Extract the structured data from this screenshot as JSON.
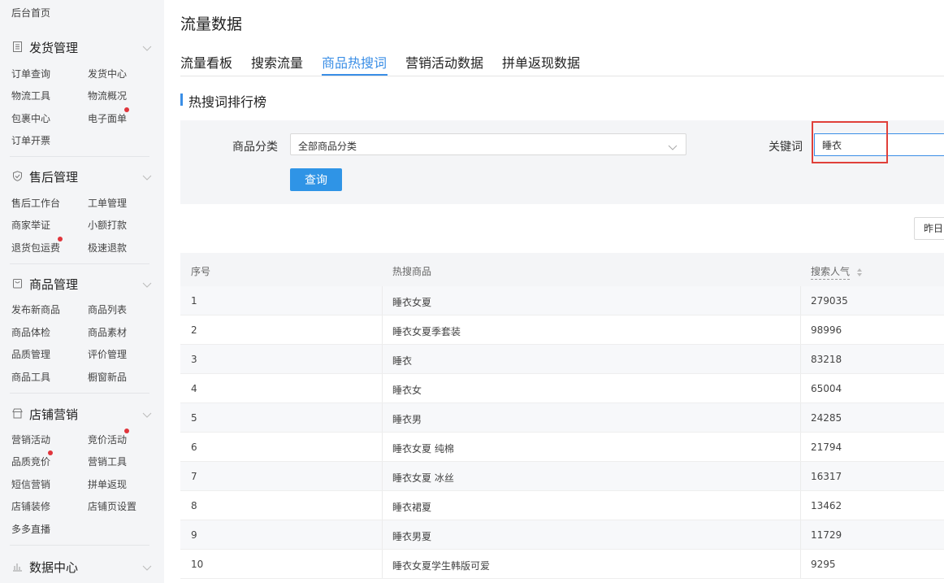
{
  "sidebar": {
    "home": "后台首页",
    "sections": [
      {
        "title": "发货管理",
        "icon": "document-icon",
        "items": [
          "订单查询",
          "发货中心",
          "物流工具",
          "物流概况",
          "包裹中心",
          "电子面单",
          "订单开票"
        ]
      },
      {
        "title": "售后管理",
        "icon": "shield-check-icon",
        "items": [
          "售后工作台",
          "工单管理",
          "商家举证",
          "小额打款",
          "退货包运费",
          "极速退款"
        ]
      },
      {
        "title": "商品管理",
        "icon": "bag-icon",
        "items": [
          "发布新商品",
          "商品列表",
          "商品体检",
          "商品素材",
          "品质管理",
          "评价管理",
          "商品工具",
          "橱窗新品"
        ]
      },
      {
        "title": "店铺营销",
        "icon": "store-icon",
        "items": [
          "营销活动",
          "竞价活动",
          "品质竞价",
          "营销工具",
          "短信营销",
          "拼单返现",
          "店铺装修",
          "店铺页设置",
          "多多直播"
        ]
      },
      {
        "title": "数据中心",
        "icon": "bar-chart-icon",
        "items": []
      }
    ]
  },
  "page": {
    "title": "流量数据"
  },
  "tabs": [
    {
      "label": "流量看板",
      "active": false
    },
    {
      "label": "搜索流量",
      "active": false
    },
    {
      "label": "商品热搜词",
      "active": true
    },
    {
      "label": "营销活动数据",
      "active": false
    },
    {
      "label": "拼单返现数据",
      "active": false
    }
  ],
  "section_title": "热搜词排行榜",
  "filters": {
    "category_label": "商品分类",
    "category_value": "全部商品分类",
    "keyword_label": "关键词",
    "keyword_value": "睡衣",
    "query_button": "查询"
  },
  "date_button": "昨日",
  "table": {
    "headers": [
      "序号",
      "热搜商品",
      "搜索人气"
    ],
    "rows": [
      {
        "rank": "1",
        "keyword": "睡衣女夏",
        "popularity": "279035"
      },
      {
        "rank": "2",
        "keyword": "睡衣女夏季套装",
        "popularity": "98996"
      },
      {
        "rank": "3",
        "keyword": "睡衣",
        "popularity": "83218"
      },
      {
        "rank": "4",
        "keyword": "睡衣女",
        "popularity": "65004"
      },
      {
        "rank": "5",
        "keyword": "睡衣男",
        "popularity": "24285"
      },
      {
        "rank": "6",
        "keyword": "睡衣女夏 纯棉",
        "popularity": "21794"
      },
      {
        "rank": "7",
        "keyword": "睡衣女夏 冰丝",
        "popularity": "16317"
      },
      {
        "rank": "8",
        "keyword": "睡衣裙夏",
        "popularity": "13462"
      },
      {
        "rank": "9",
        "keyword": "睡衣男夏",
        "popularity": "11729"
      },
      {
        "rank": "10",
        "keyword": "睡衣女夏学生韩版可爱",
        "popularity": "9295"
      }
    ]
  },
  "colors": {
    "accent": "#3a8ee6",
    "button": "#2f94e6",
    "highlight": "#e0403a",
    "badge": "#e0353c"
  }
}
